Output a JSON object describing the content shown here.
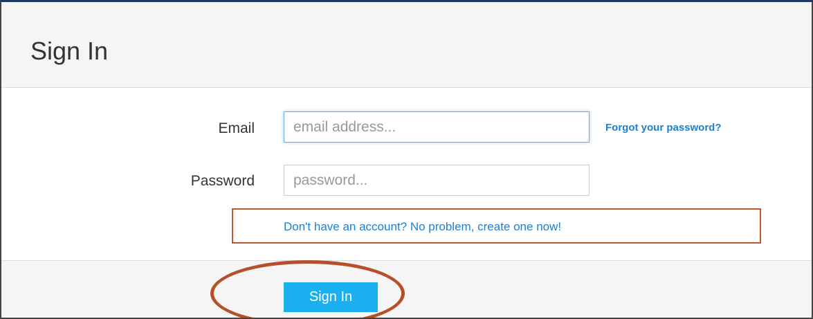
{
  "page": {
    "title": "Sign In"
  },
  "form": {
    "email_label": "Email",
    "email_placeholder": "email address...",
    "email_value": "",
    "password_label": "Password",
    "password_placeholder": "password...",
    "password_value": "",
    "forgot_link": "Forgot your password?",
    "signup_link": "Don't have an account? No problem, create one now!"
  },
  "footer": {
    "signin_label": "Sign In"
  },
  "colors": {
    "accent": "#1ab0f0",
    "link": "#1e7fd0",
    "annotation": "#b5502a",
    "header_bg": "#f5f5f5"
  }
}
